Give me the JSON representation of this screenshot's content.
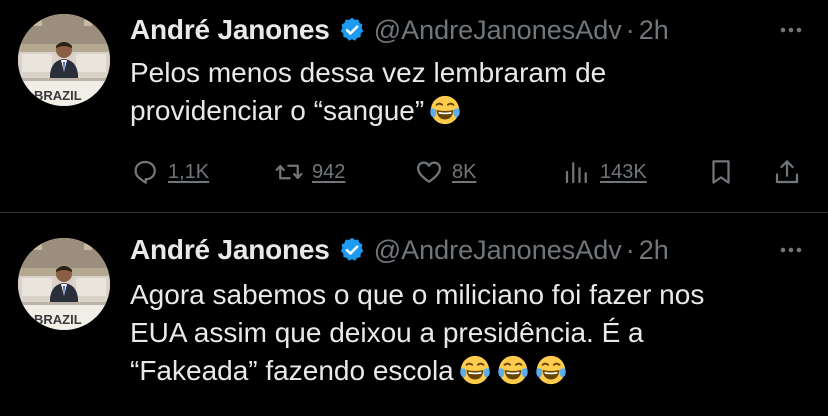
{
  "tweets": [
    {
      "author_name": "André Janones",
      "handle": "@AndreJanonesAdv",
      "separator": "·",
      "time": "2h",
      "avatar_text": "BRAZIL",
      "text_lines": [
        "Pelos menos dessa vez lembraram de",
        "providenciar o “sangue”"
      ],
      "emoji": [
        "face-with-tears-of-joy"
      ],
      "actions": {
        "replies": "1,1K",
        "retweets": "942",
        "likes": "8K",
        "views": "143K"
      }
    },
    {
      "author_name": "André Janones",
      "handle": "@AndreJanonesAdv",
      "separator": "·",
      "time": "2h",
      "avatar_text": "BRAZIL",
      "text_lines": [
        "Agora sabemos o que o miliciano foi fazer nos",
        "EUA assim que deixou a presidência. É a",
        "“Fakeada” fazendo escola"
      ],
      "emoji": [
        "face-with-tears-of-joy",
        "face-with-tears-of-joy",
        "face-with-tears-of-joy"
      ]
    }
  ],
  "colors": {
    "background": "#000000",
    "text": "#e7e9ea",
    "secondary": "#71767b",
    "verified": "#1d9bf0",
    "divider": "#2f3336"
  },
  "icons": [
    "reply-icon",
    "retweet-icon",
    "like-icon",
    "views-icon",
    "bookmark-icon",
    "share-icon",
    "more-icon",
    "verified-badge-icon"
  ]
}
